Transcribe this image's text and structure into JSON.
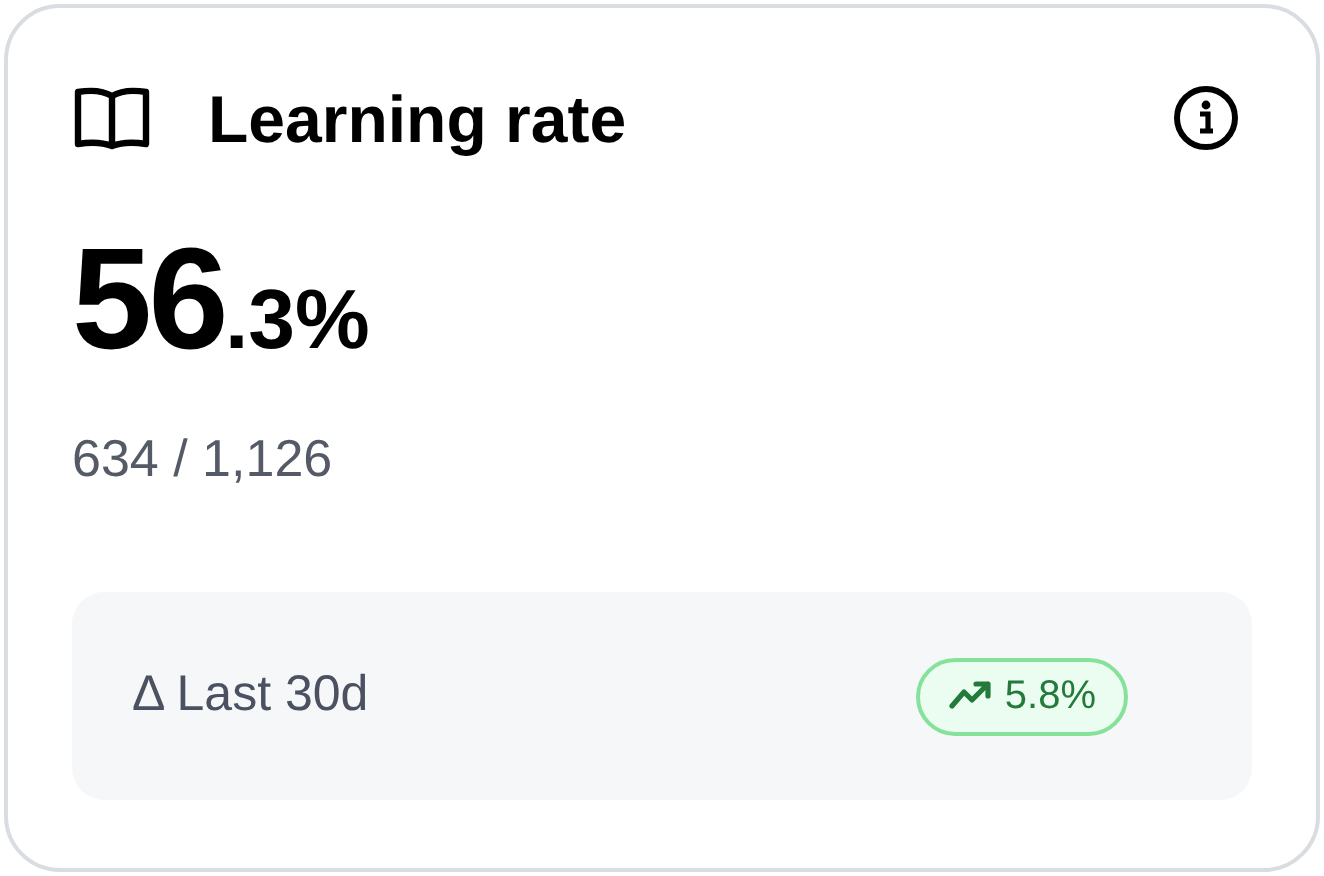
{
  "card": {
    "title": "Learning rate",
    "value_whole": "56",
    "value_fraction": ".3%",
    "detail": "634 / 1,126"
  },
  "change": {
    "label": "Δ Last 30d",
    "value": "5.8%",
    "rising": true
  }
}
